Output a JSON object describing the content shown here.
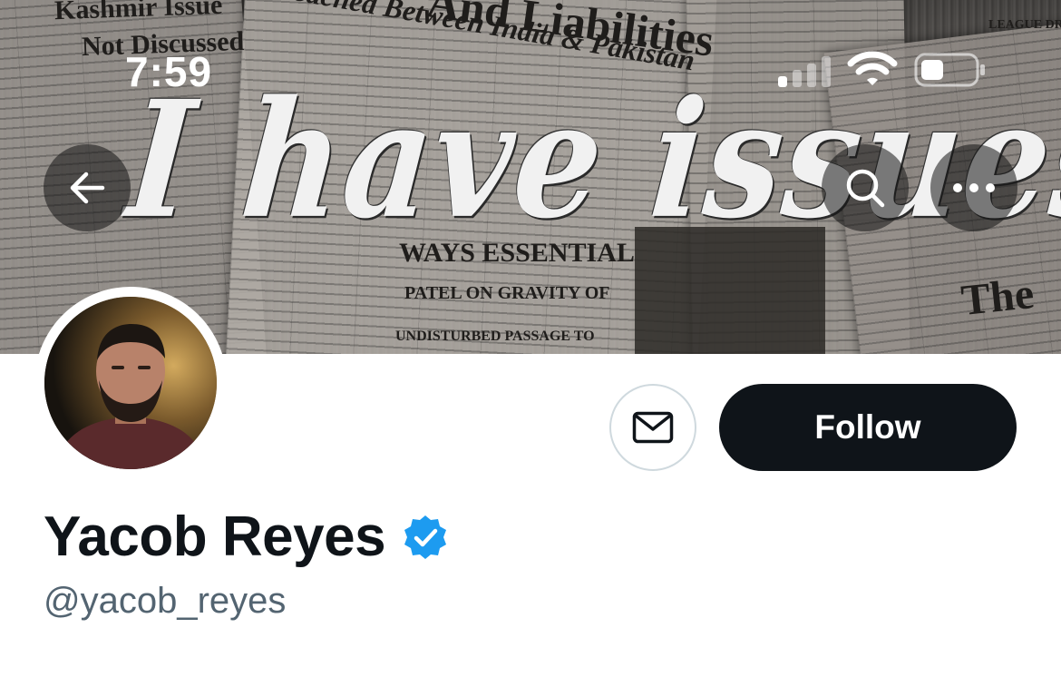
{
  "status_bar": {
    "time": "7:59"
  },
  "banner": {
    "title": "I have issues",
    "newspaper_lines": {
      "l1": "Kashmir Issue",
      "l2": "Not Discussed",
      "l3": "Reached Between India & Pakistan",
      "l4": "And Liabilities",
      "l5": "WAYS ESSENTIAL",
      "l6": "PATEL ON GRAVITY OF",
      "l7": "UNDISTURBED PASSAGE TO",
      "l8": "The",
      "l9": "LEAGUE DREAM OF EMPIRE"
    }
  },
  "nav": {
    "back_icon": "arrow-left-icon",
    "search_icon": "search-icon",
    "more_icon": "more-horizontal-icon"
  },
  "profile": {
    "display_name": "Yacob Reyes",
    "handle": "@yacob_reyes",
    "verified": true,
    "verified_color": "#1d9bf0"
  },
  "actions": {
    "message_icon": "mail-icon",
    "follow_label": "Follow"
  },
  "colors": {
    "follow_bg": "#0f1419",
    "handle_text": "#536471"
  }
}
